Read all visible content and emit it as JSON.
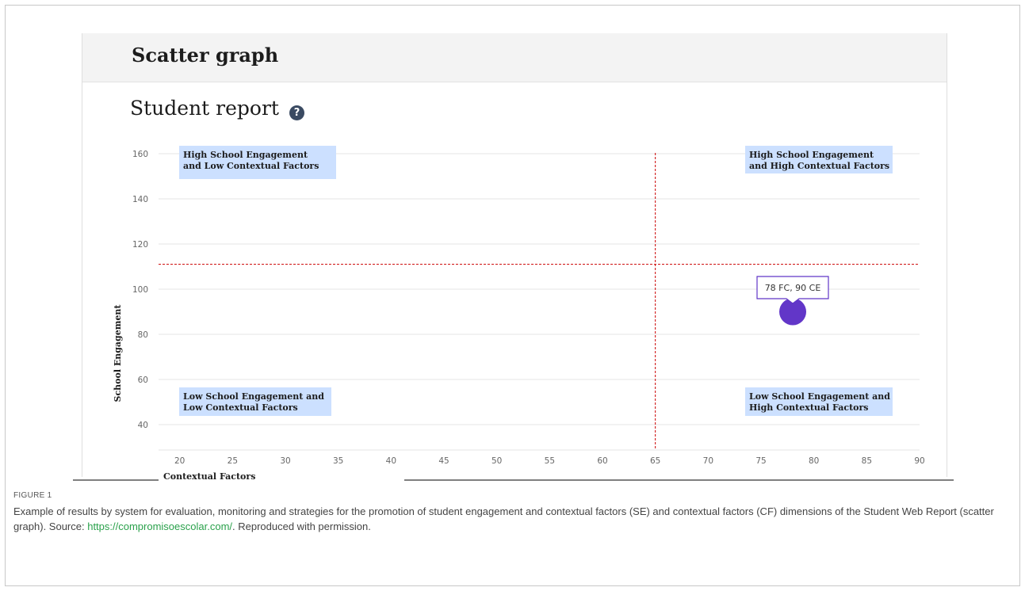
{
  "app": {
    "title": "Scatter graph",
    "report_title": "Student report",
    "help_icon": "question-circle-icon"
  },
  "chart_data": {
    "type": "scatter",
    "xlabel": "Contextual Factors",
    "ylabel": "School Engagement",
    "xlim": [
      18,
      90
    ],
    "ylim": [
      28,
      160
    ],
    "x_ticks": [
      20,
      25,
      30,
      35,
      40,
      45,
      50,
      55,
      60,
      65,
      70,
      75,
      80,
      85,
      90
    ],
    "y_ticks": [
      40,
      60,
      80,
      100,
      120,
      140,
      160
    ],
    "grid": "horizontal",
    "series": [
      {
        "points": [
          {
            "x": 78,
            "y": 90
          }
        ],
        "color": "#6236c8"
      }
    ],
    "threshold_lines": [
      {
        "axis": "x",
        "value": 65,
        "color": "#cc0000"
      },
      {
        "axis": "y",
        "value": 111,
        "color": "#cc0000"
      }
    ],
    "quadrant_labels": [
      {
        "position": "top-left",
        "lines": [
          "High School Engagement",
          "and Low Contextual Factors"
        ]
      },
      {
        "position": "top-right",
        "lines": [
          "High School Engagement",
          "and High Contextual Factors"
        ]
      },
      {
        "position": "bottom-left",
        "lines": [
          "Low School Engagement and",
          "Low Contextual Factors"
        ]
      },
      {
        "position": "bottom-right",
        "lines": [
          "Low School Engagement and",
          "High Contextual Factors"
        ]
      }
    ],
    "tooltip": "78 FC, 90 CE",
    "label_bg_color": "#cce0ff"
  },
  "caption": {
    "label": "FIGURE 1",
    "text_before": "Example of results by system for evaluation, monitoring and strategies for the promotion of student engagement and contextual factors (SE) and contextual factors (CF) dimensions of the Student Web Report (scatter graph). Source: ",
    "link": "https://compromisoescolar.com/",
    "text_after": ". Reproduced with permission."
  }
}
